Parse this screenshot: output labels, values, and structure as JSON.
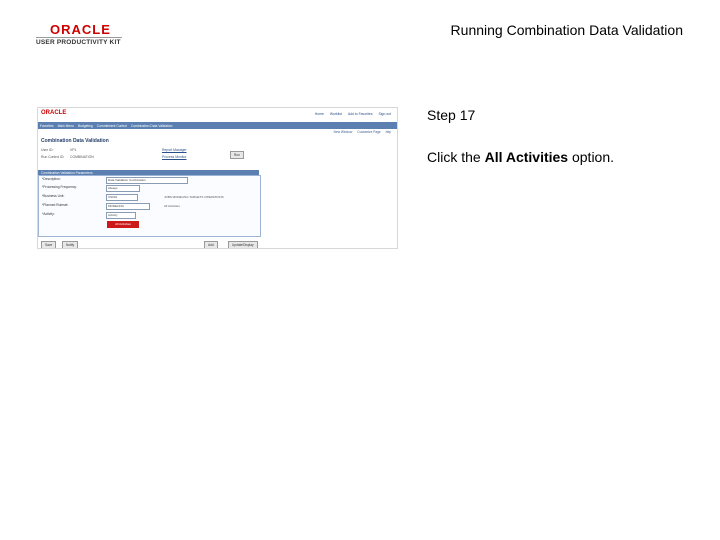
{
  "header": {
    "logo_oracle": "ORACLE",
    "logo_product": "USER PRODUCTIVITY KIT",
    "document_title": "Running Combination Data Validation"
  },
  "step": {
    "label": "Step 17",
    "instruction_prefix": "Click the ",
    "instruction_target": "All Activities",
    "instruction_suffix": " option."
  },
  "screenshot": {
    "brand": "ORACLE",
    "top_links": [
      "Home",
      "Worklist",
      "Add to Favorites",
      "Sign out"
    ],
    "menu_items": [
      "Favorites",
      "Main Menu",
      "Budgeting",
      "Commitment Control",
      "Combination Data Validation"
    ],
    "utility_links": [
      "New Window",
      "Customize Page",
      "http"
    ],
    "page_title": "Combination Data Validation",
    "user_id_label": "User ID:",
    "user_id_value": "VP1",
    "run_control_label": "Run Control ID:",
    "run_control_value": "COMBINATION",
    "report_manager": "Report Manager",
    "process_monitor": "Process Monitor",
    "run_button": "Run",
    "section_title": "Combination Validation Parameters",
    "fields": [
      {
        "label": "*Description:",
        "value": "Data Validation Combination"
      },
      {
        "label": "*Processing Frequency:",
        "value": "Always"
      },
      {
        "label": "*Business Unit:",
        "value": "US001"
      },
      {
        "label": "*Planned Ruleset:",
        "value": "MODELING"
      },
      {
        "label": "*Activity:",
        "value": "Activity"
      }
    ],
    "notes": [
      "JOBS MODELING TARGETS OPERATIONS",
      "All Activities"
    ],
    "highlighted_option": "All Activities",
    "bottom_buttons_left": [
      "Save",
      "Notify"
    ],
    "bottom_buttons_right": [
      "Add",
      "Update/Display"
    ],
    "colors": {
      "menu_bar": "#5a7fb0",
      "highlight": "#cc1a1a",
      "brand": "#cc0000"
    }
  }
}
